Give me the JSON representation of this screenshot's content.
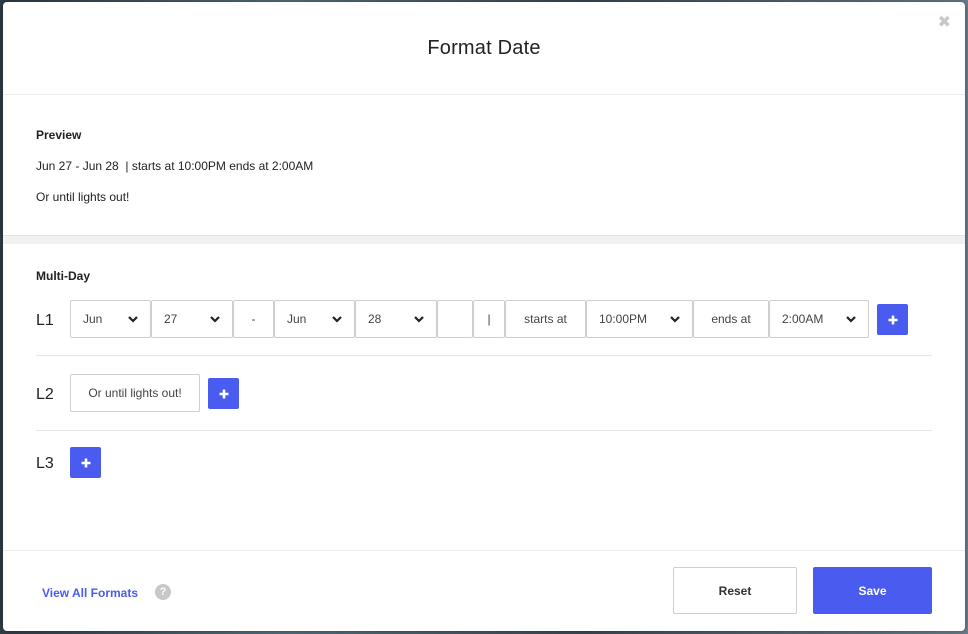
{
  "dialog": {
    "title": "Format Date",
    "close_icon": "close-icon",
    "close_glyph": "✖"
  },
  "preview": {
    "heading": "Preview",
    "line1": "Jun 27 - Jun 28  | starts at 10:00PM ends at 2:00AM",
    "line2": "Or until lights out!"
  },
  "multiday": {
    "heading": "Multi-Day",
    "l1": {
      "label": "L1",
      "start_month": "Jun",
      "start_day": "27",
      "dash": "-",
      "end_month": "Jun",
      "end_day": "28",
      "blank": "",
      "pipe": "|",
      "starts_at_text": "starts at",
      "start_time": "10:00PM",
      "ends_at_text": "ends at",
      "end_time": "2:00AM"
    },
    "l2": {
      "label": "L2",
      "text": "Or until lights out!"
    },
    "l3": {
      "label": "L3"
    }
  },
  "footer": {
    "view_all": "View All Formats",
    "help_glyph": "?",
    "reset": "Reset",
    "save": "Save"
  },
  "colors": {
    "accent": "#4a5cf0"
  }
}
